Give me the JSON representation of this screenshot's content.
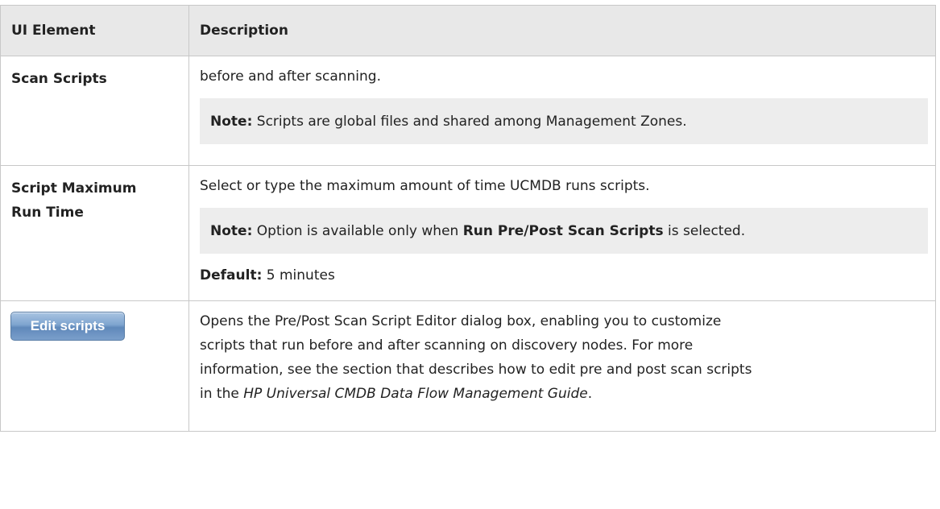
{
  "header": {
    "col1": "UI Element",
    "col2": "Description"
  },
  "rows": {
    "scan_scripts": {
      "name": "Scan Scripts",
      "text": "before and after scanning.",
      "note_label": "Note:",
      "note_text": " Scripts are global files and shared among Management Zones."
    },
    "max_run_time": {
      "name_line1": "Script Maximum",
      "name_line2": "Run Time",
      "text": "Select or type the maximum amount of time UCMDB runs scripts.",
      "note_label": "Note:",
      "note_text_1": " Option is available only when ",
      "note_bold": "Run Pre/Post Scan Scripts",
      "note_text_2": " is selected.",
      "default_label": "Default:",
      "default_value": " 5 minutes"
    },
    "edit_scripts": {
      "button_label": "Edit scripts",
      "text_line1": "Opens the Pre/Post Scan Script Editor dialog box, enabling you to customize",
      "text_line2": "scripts that run before and after scanning on discovery nodes. For more",
      "text_line3": "information, see the section that describes how to edit pre and post scan scripts",
      "text_line4_pre": "in the ",
      "text_line4_italic": "HP Universal CMDB Data Flow Management Guide",
      "text_line4_post": "."
    }
  }
}
